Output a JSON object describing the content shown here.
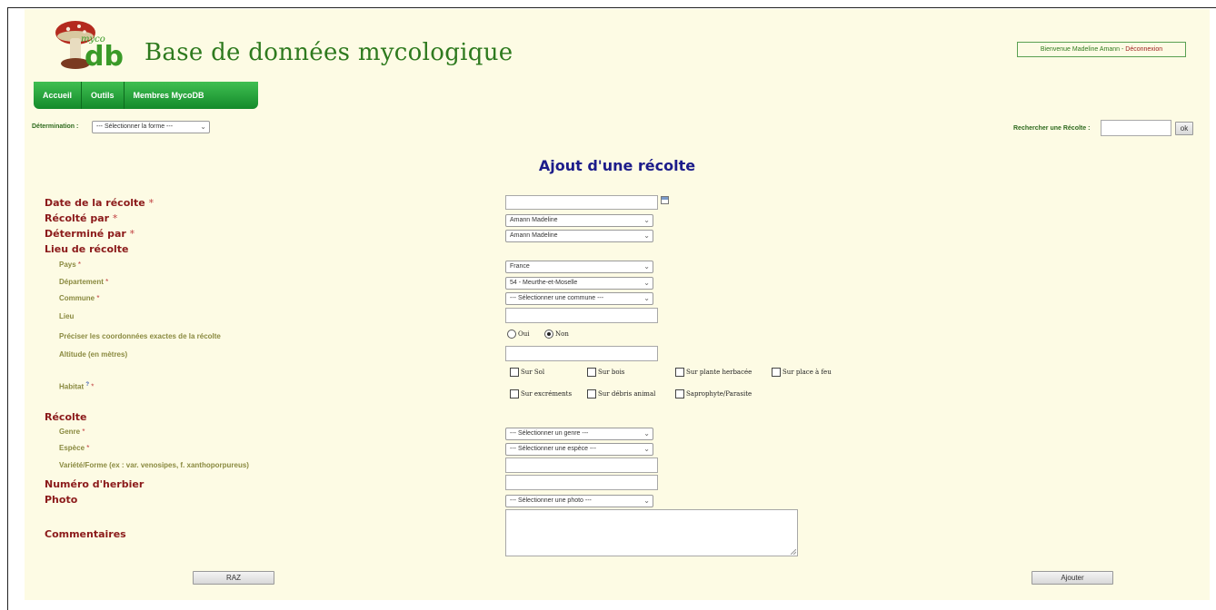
{
  "header": {
    "logo_text": "myco db",
    "site_title": "Base de données mycologique",
    "welcome_text": "Bienvenue Madeline Amann",
    "logout_label": "Déconnexion"
  },
  "nav": {
    "items": [
      {
        "label": "Accueil"
      },
      {
        "label": "Outils"
      },
      {
        "label": "Membres MycoDB"
      }
    ]
  },
  "toolbar": {
    "determination_label": "Détermination :",
    "determination_value": "--- Sélectionner la forme ---",
    "search_label": "Rechercher une Récolte :",
    "search_value": "",
    "ok_label": "ok"
  },
  "form": {
    "title": "Ajout d'une récolte",
    "required_marker": "*",
    "date_label": "Date de la récolte",
    "date_value": "",
    "recolte_par_label": "Récolté par",
    "recolte_par_value": "Amann Madeline",
    "determine_par_label": "Déterminé par",
    "determine_par_value": "Amann Madeline",
    "lieu_label": "Lieu de récolte",
    "pays_label": "Pays",
    "pays_value": "France",
    "departement_label": "Département",
    "departement_value": "54 - Meurthe-et-Moselle",
    "commune_label": "Commune",
    "commune_value": "--- Sélectionner une commune ---",
    "lieu_field_label": "Lieu",
    "lieu_value": "",
    "coords_label": "Préciser les coordonnées exactes de la récolte",
    "coords_yes": "Oui",
    "coords_no": "Non",
    "coords_selected": "Non",
    "altitude_label": "Altitude (en mètres)",
    "altitude_value": "",
    "habitat_label": "Habitat",
    "habitat_options": [
      {
        "label": "Sur Sol",
        "checked": false
      },
      {
        "label": "Sur bois",
        "checked": false
      },
      {
        "label": "Sur plante herbacée",
        "checked": false
      },
      {
        "label": "Sur place à feu",
        "checked": false
      },
      {
        "label": "Sur excréments",
        "checked": false
      },
      {
        "label": "Sur débris animal",
        "checked": false
      },
      {
        "label": "Saprophyte/Parasite",
        "checked": false
      }
    ],
    "recolte_label": "Récolte",
    "genre_label": "Genre",
    "genre_value": "--- Sélectionner un genre ---",
    "espece_label": "Espèce",
    "espece_value": "--- Sélectionner une espèce ---",
    "variete_label": "Variété/Forme (ex : var. venosipes, f. xanthoporpureus)",
    "variete_value": "",
    "herbier_label": "Numéro d'herbier",
    "herbier_value": "",
    "photo_label": "Photo",
    "photo_value": "--- Sélectionner une photo ---",
    "commentaires_label": "Commentaires",
    "commentaires_value": "",
    "reset_label": "RAZ",
    "submit_label": "Ajouter"
  },
  "colors": {
    "background": "#fdfbe4",
    "nav_green": "#1f9a35",
    "title_blue": "#1c1c8a",
    "label_red": "#8b1a1a",
    "sublabel_olive": "#8a8a40"
  }
}
